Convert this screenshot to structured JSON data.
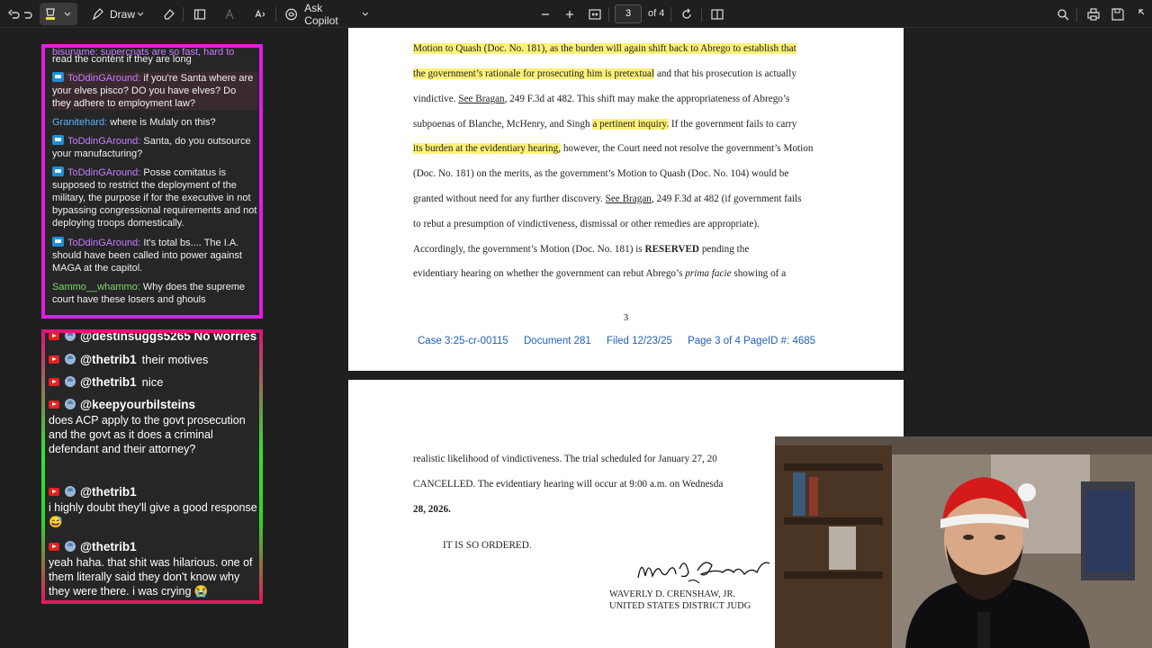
{
  "toolbar": {
    "draw_label": "Draw",
    "copilot_label": "Ask Copilot",
    "page_current": "3",
    "page_total": "of 4"
  },
  "document": {
    "page1_lines": [
      {
        "segments": [
          {
            "t": "Motion to Quash (Doc. No. 181), ",
            "hl": true
          },
          {
            "t": "as the burden will again shift back to Abrego to establish that",
            "hl": true
          }
        ]
      },
      {
        "segments": [
          {
            "t": "the government’s rationale for prosecuting him is pretextual",
            "hl": true
          },
          {
            "t": " and that his prosecution is actually",
            "hl": false
          }
        ]
      },
      {
        "segments": [
          {
            "t": "vindictive.  ",
            "hl": false
          },
          {
            "t": "See Bragan",
            "u": true
          },
          {
            "t": ", 249 F.3d at 482.  This shift may make the appropriateness of Abrego’s",
            "hl": false
          }
        ]
      },
      {
        "segments": [
          {
            "t": "subpoenas of Blanche, McHenry, and Singh ",
            "hl": false
          },
          {
            "t": "a pertinent inquiry.",
            "hl": true
          },
          {
            "t": "  If the government fails to carry",
            "hl": false
          }
        ]
      },
      {
        "segments": [
          {
            "t": "its burden at the evidentiary hearing,",
            "hl": true
          },
          {
            "t": " however, the Court need not resolve the government’s Motion",
            "hl": false
          }
        ]
      },
      {
        "segments": [
          {
            "t": "(Doc. No. 181) on the merits, as the government’s Motion to Quash (Doc. No. 104) would be",
            "hl": false
          }
        ]
      },
      {
        "segments": [
          {
            "t": "granted without need for any further discovery.  ",
            "hl": false
          },
          {
            "t": "See Bragan",
            "u": true
          },
          {
            "t": ", 249 F.3d at 482 (if government fails",
            "hl": false
          }
        ]
      },
      {
        "segments": [
          {
            "t": "to rebut a presumption of vindictiveness, dismissal or other remedies are appropriate).",
            "hl": false
          }
        ]
      },
      {
        "segments": [
          {
            "t": "      Accordingly, the government’s Motion (Doc. No. 181) is ",
            "hl": false
          },
          {
            "t": "RESERVED",
            "b": true
          },
          {
            "t": " pending the",
            "hl": false
          }
        ]
      },
      {
        "segments": [
          {
            "t": "evidentiary hearing on whether the government can rebut Abrego’s ",
            "hl": false
          },
          {
            "t": "prima facie",
            "i": true
          },
          {
            "t": " showing of a",
            "hl": false
          }
        ]
      }
    ],
    "page1_number": "3",
    "footer": {
      "case": "Case 3:25-cr-00115",
      "document": "Document 281",
      "filed": "Filed 12/23/25",
      "page": "Page 3 of 4 PageID #: 4685"
    },
    "page2_lines": [
      "realistic likelihood of vindictiveness.   The trial scheduled for January 27, 20",
      "CANCELLED.  The evidentiary hearing will occur at 9:00 a.m. on Wednesda",
      "28, 2026."
    ],
    "ordered": "IT IS SO ORDERED.",
    "signer_name": "WAVERLY D. CRENSHAW, JR.",
    "signer_title": "UNITED STATES DISTRICT JUDG"
  },
  "chat1": {
    "messages": [
      {
        "user": "",
        "text": "read the content if they are long",
        "badge": false,
        "color": "#e6e6e6"
      },
      {
        "user": "ToDdinGAround:",
        "text": " if you're Santa where are your elves pisco? DO you have elves? Do they adhere to employment law?",
        "badge": true,
        "color": "#c77dff"
      },
      {
        "user": "Granitehard:",
        "text": " where is Mulaly on this?",
        "badge": false,
        "color": "#5db1ff"
      },
      {
        "user": "ToDdinGAround:",
        "text": " Santa, do you outsource your manufacturing?",
        "badge": true,
        "color": "#c77dff"
      },
      {
        "user": "ToDdinGAround:",
        "text": " Posse comitatus is supposed to restrict the deployment of the military, the purpose if for the executive in not bypassing congressional requirements and not deploying troops domestically.",
        "badge": true,
        "color": "#c77dff"
      },
      {
        "user": "ToDdinGAround:",
        "text": " It's total bs.... The I.A. should have been called into power against MAGA at the capitol.",
        "badge": true,
        "color": "#c77dff"
      },
      {
        "user": "Sammo__whammo:",
        "text": " Why does the supreme court have these losers and ghouls",
        "badge": false,
        "color": "#7fd66b"
      }
    ]
  },
  "chat2": {
    "top_partial": "@destinsuggs5265  No worries",
    "rows": [
      {
        "user": "@thetrib1",
        "inline": "their motives",
        "text": ""
      },
      {
        "user": "@thetrib1",
        "inline": "nice",
        "text": ""
      },
      {
        "user": "@keepyourbilsteins",
        "inline": "",
        "text": "does ACP apply to the govt prosecution and the govt as it does a criminal defendant and their attorney?"
      },
      {
        "user": "@thetrib1",
        "inline": "",
        "text": "i highly doubt they'll give a good response 😅"
      },
      {
        "user": "@thetrib1",
        "inline": "",
        "text": "yeah haha. that shit was hilarious. one of them literally said they don't know why they were there. i was crying 😭"
      }
    ]
  },
  "colors": {
    "highlight": "#fff176",
    "footer_link": "#1f5fb5",
    "chat1_border": "#e01ee0",
    "youtube_red": "#e52020"
  }
}
